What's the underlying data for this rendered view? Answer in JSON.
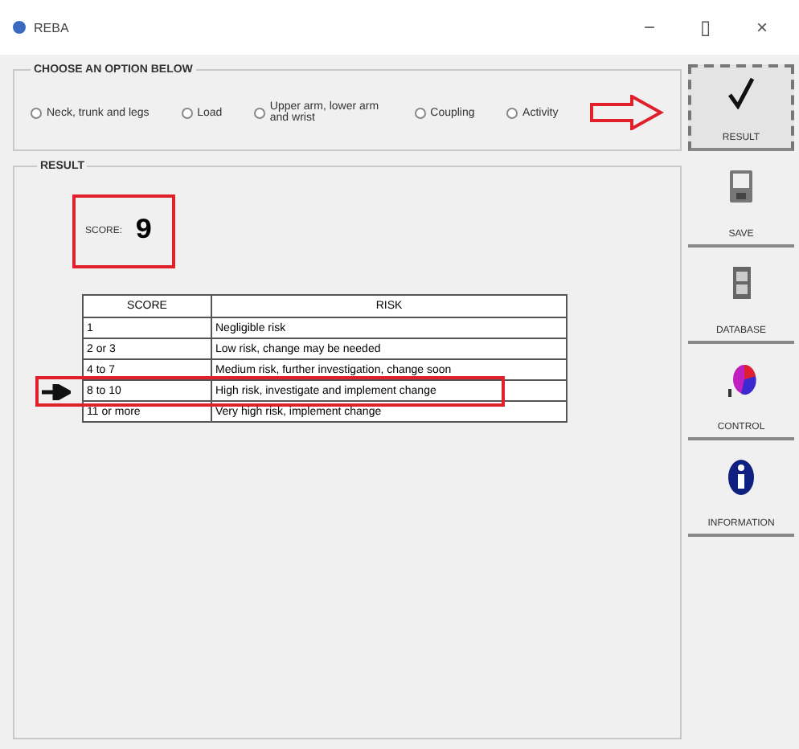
{
  "window": {
    "title": "REBA",
    "controls": [
      "−",
      "▯",
      "×"
    ]
  },
  "options": {
    "title": "CHOOSE AN OPTION BELOW",
    "items": [
      {
        "label": "Neck, trunk and legs",
        "selected": false
      },
      {
        "label": "Load",
        "selected": false
      },
      {
        "label": "Upper arm, lower arm and wrist",
        "selected": false
      },
      {
        "label": "Coupling",
        "selected": false
      },
      {
        "label": "Activity",
        "selected": false
      }
    ]
  },
  "result": {
    "title": "RESULT",
    "score_label": "SCORE:",
    "score": "9",
    "columns": [
      "SCORE",
      "RISK"
    ],
    "rows": [
      {
        "score": "1",
        "risk": "Negligible risk",
        "marked": false
      },
      {
        "score": "2 or 3",
        "risk": "Low risk, change may be needed",
        "marked": false
      },
      {
        "score": "4 to 7",
        "risk": "Medium risk, further investigation, change soon",
        "marked": false
      },
      {
        "score": "8 to 10",
        "risk": "High risk, investigate and implement change",
        "marked": true
      },
      {
        "score": "11 or more",
        "risk": "Very high risk, implement change",
        "marked": false
      }
    ]
  },
  "toolbar": [
    {
      "kind": "check",
      "label": "RESULT",
      "pressed": true
    },
    {
      "kind": "save",
      "label": "SAVE",
      "pressed": false
    },
    {
      "kind": "database",
      "label": "DATABASE",
      "pressed": false
    },
    {
      "kind": "control",
      "label": "CONTROL",
      "pressed": false
    },
    {
      "kind": "info",
      "label": "INFORMATION",
      "pressed": false
    }
  ]
}
